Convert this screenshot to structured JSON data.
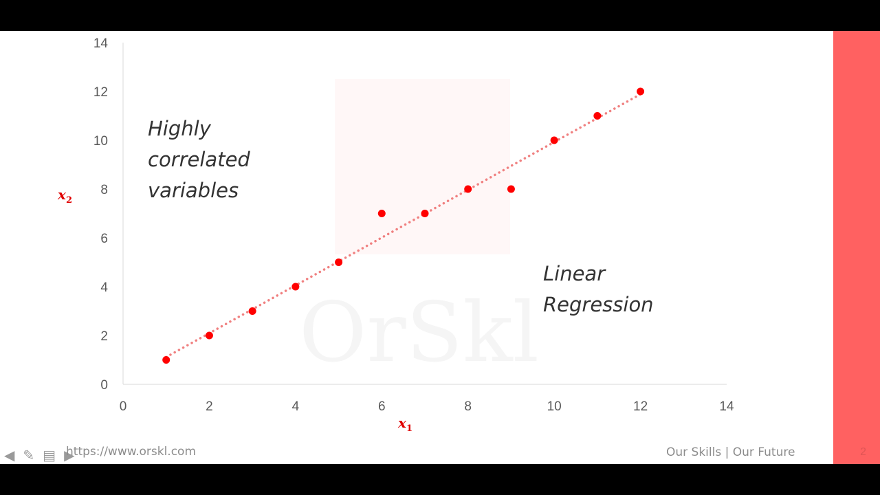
{
  "chart_data": {
    "type": "scatter",
    "x": [
      1,
      2,
      3,
      4,
      5,
      6,
      7,
      8,
      9,
      10,
      11,
      12
    ],
    "y": [
      1,
      2,
      3,
      4,
      5,
      7,
      7,
      8,
      8,
      10,
      11,
      12
    ],
    "xlabel": "x1",
    "ylabel": "x2",
    "xlim": [
      0,
      14
    ],
    "ylim": [
      0,
      14
    ],
    "xticks": [
      "0",
      "2",
      "4",
      "6",
      "8",
      "10",
      "12",
      "14"
    ],
    "yticks": [
      "0",
      "2",
      "4",
      "6",
      "8",
      "10",
      "12",
      "14"
    ],
    "trendline": "linear, dotted",
    "grid": false,
    "point_color": "#ff0000",
    "trendline_color": "#f08080"
  },
  "annotations": {
    "left": [
      "Highly",
      "correlated",
      "variables"
    ],
    "right": [
      "Linear",
      "Regression"
    ]
  },
  "axis_labels": {
    "x_var": "x",
    "x_sub": "1",
    "y_var": "x",
    "y_sub": "2"
  },
  "footer": {
    "url": "https://www.orskl.com",
    "tagline": "Our Skills | Our Future",
    "slide_number": "2"
  },
  "watermark": "OrSkl",
  "colors": {
    "accent_band": "#ff6161"
  }
}
